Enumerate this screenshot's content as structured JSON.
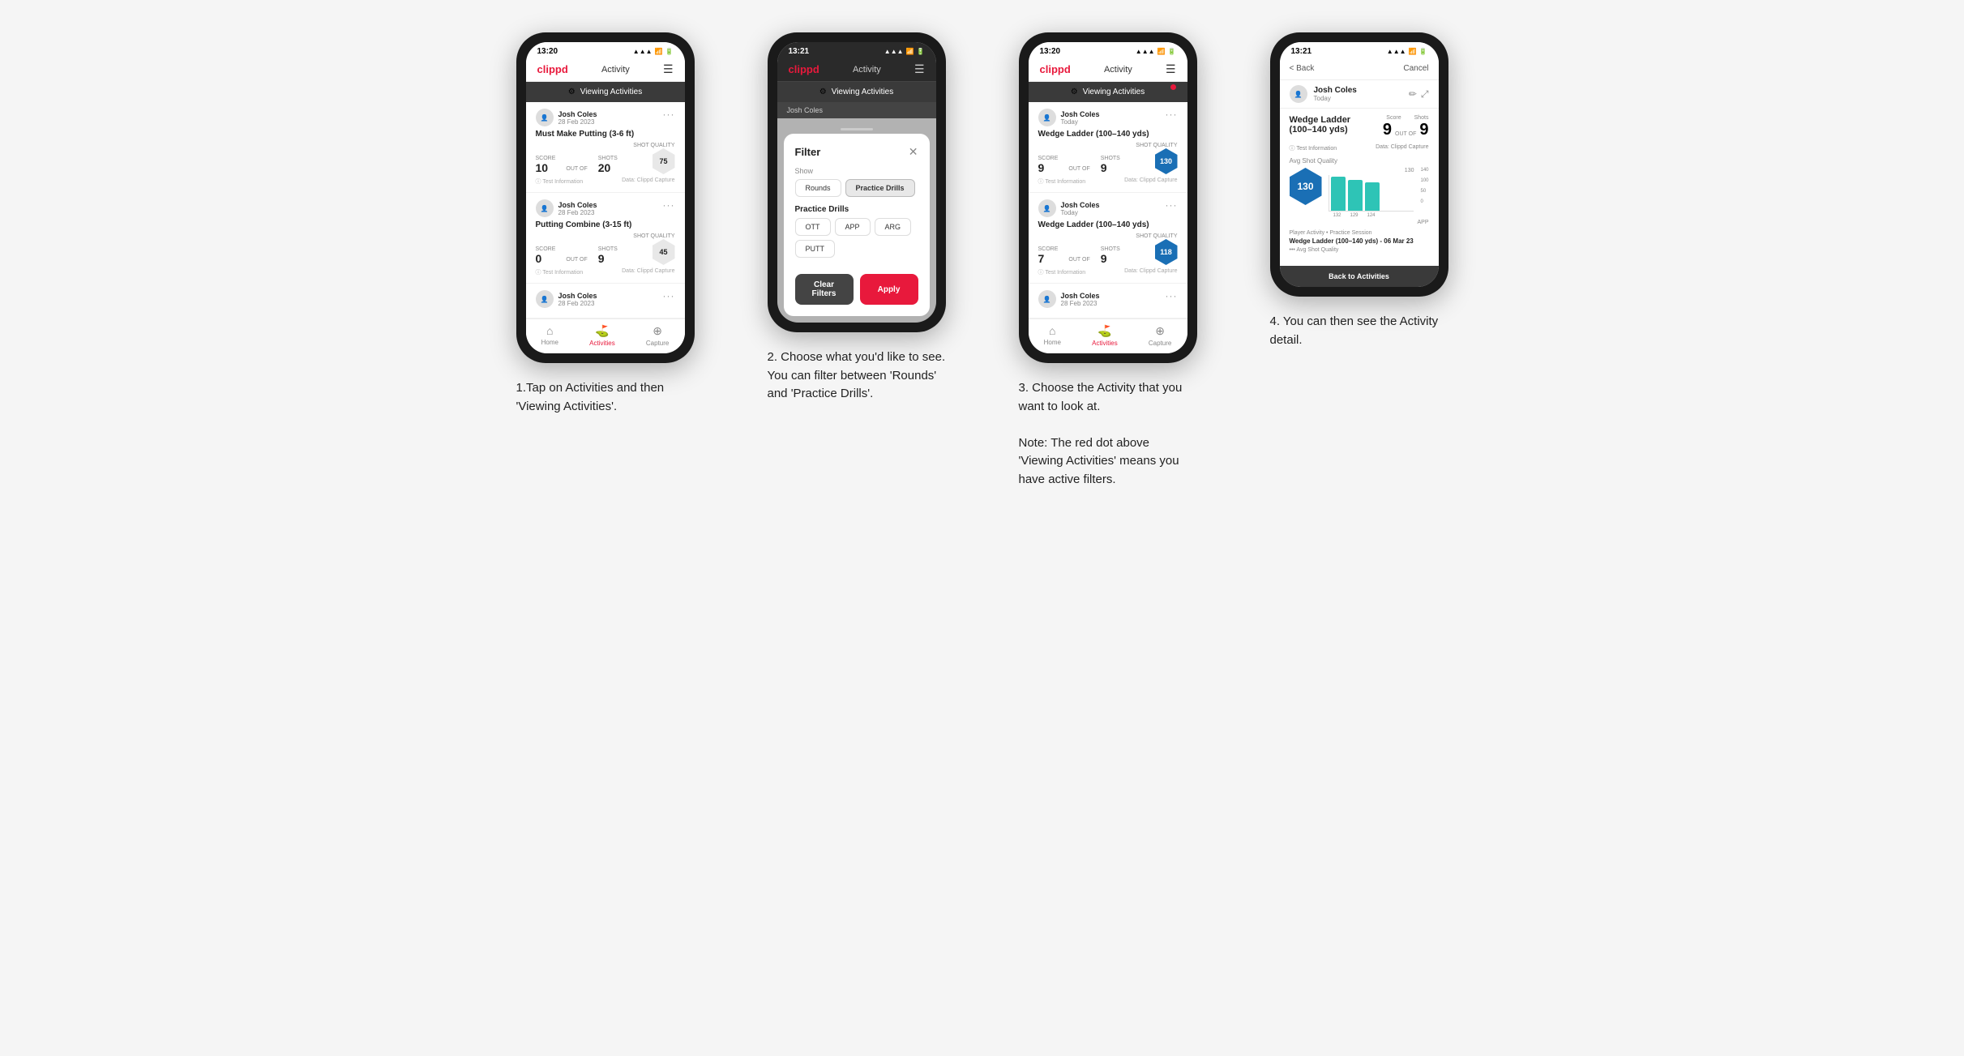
{
  "steps": [
    {
      "id": "step1",
      "phone": {
        "time": "13:20",
        "header": {
          "logo": "clippd",
          "title": "Activity",
          "icon": "☰"
        },
        "viewing_bar": "Viewing Activities",
        "cards": [
          {
            "user": "Josh Coles",
            "date": "28 Feb 2023",
            "title": "Must Make Putting (3-6 ft)",
            "score_label": "Score",
            "shots_label": "Shots",
            "sq_label": "Shot Quality",
            "score": "10",
            "outof": "OUT OF",
            "shots": "20",
            "sq": "75",
            "sq_blue": false,
            "footer_left": "Test Information",
            "footer_right": "Data: Clippd Capture"
          },
          {
            "user": "Josh Coles",
            "date": "28 Feb 2023",
            "title": "Putting Combine (3-15 ft)",
            "score_label": "Score",
            "shots_label": "Shots",
            "sq_label": "Shot Quality",
            "score": "0",
            "outof": "OUT OF",
            "shots": "9",
            "sq": "45",
            "sq_blue": false,
            "footer_left": "Test Information",
            "footer_right": "Data: Clippd Capture"
          },
          {
            "user": "Josh Coles",
            "date": "28 Feb 2023",
            "title": "",
            "score_label": "",
            "shots_label": "",
            "sq_label": "",
            "score": "",
            "outof": "",
            "shots": "",
            "sq": "",
            "sq_blue": false,
            "footer_left": "",
            "footer_right": ""
          }
        ],
        "nav": [
          {
            "label": "Home",
            "icon": "⌂",
            "active": false
          },
          {
            "label": "Activities",
            "icon": "♟",
            "active": true
          },
          {
            "label": "Capture",
            "icon": "⊕",
            "active": false
          }
        ]
      },
      "caption": "1.Tap on Activities and then 'Viewing Activities'."
    },
    {
      "id": "step2",
      "phone": {
        "time": "13:21",
        "header": {
          "logo": "clippd",
          "title": "Activity",
          "icon": "☰"
        },
        "viewing_bar": "Viewing Activities",
        "partial_user": "Josh Coles",
        "filter": {
          "title": "Filter",
          "show_label": "Show",
          "show_options": [
            "Rounds",
            "Practice Drills"
          ],
          "active_show": "Practice Drills",
          "practice_label": "Practice Drills",
          "practice_options": [
            "OTT",
            "APP",
            "ARG",
            "PUTT"
          ],
          "clear_label": "Clear Filters",
          "apply_label": "Apply"
        },
        "nav": [
          {
            "label": "Home",
            "icon": "⌂",
            "active": false
          },
          {
            "label": "Activities",
            "icon": "♟",
            "active": true
          },
          {
            "label": "Capture",
            "icon": "⊕",
            "active": false
          }
        ]
      },
      "caption": "2. Choose what you'd like to see. You can filter between 'Rounds' and 'Practice Drills'."
    },
    {
      "id": "step3",
      "phone": {
        "time": "13:20",
        "header": {
          "logo": "clippd",
          "title": "Activity",
          "icon": "☰"
        },
        "viewing_bar": "Viewing Activities",
        "red_dot": true,
        "cards": [
          {
            "user": "Josh Coles",
            "date": "Today",
            "title": "Wedge Ladder (100–140 yds)",
            "score_label": "Score",
            "shots_label": "Shots",
            "sq_label": "Shot Quality",
            "score": "9",
            "outof": "OUT OF",
            "shots": "9",
            "sq": "130",
            "sq_blue": true,
            "footer_left": "Test Information",
            "footer_right": "Data: Clippd Capture"
          },
          {
            "user": "Josh Coles",
            "date": "Today",
            "title": "Wedge Ladder (100–140 yds)",
            "score_label": "Score",
            "shots_label": "Shots",
            "sq_label": "Shot Quality",
            "score": "7",
            "outof": "OUT OF",
            "shots": "9",
            "sq": "118",
            "sq_blue": true,
            "footer_left": "Test Information",
            "footer_right": "Data: Clippd Capture"
          },
          {
            "user": "Josh Coles",
            "date": "28 Feb 2023",
            "title": "",
            "score_label": "",
            "shots_label": "",
            "sq_label": "",
            "score": "",
            "outof": "",
            "shots": "",
            "sq": "",
            "sq_blue": false,
            "footer_left": "",
            "footer_right": ""
          }
        ],
        "nav": [
          {
            "label": "Home",
            "icon": "⌂",
            "active": false
          },
          {
            "label": "Activities",
            "icon": "♟",
            "active": true
          },
          {
            "label": "Capture",
            "icon": "⊕",
            "active": false
          }
        ]
      },
      "caption": "3. Choose the Activity that you want to look at.\n\nNote: The red dot above 'Viewing Activities' means you have active filters."
    },
    {
      "id": "step4",
      "phone": {
        "time": "13:21",
        "back_label": "< Back",
        "cancel_label": "Cancel",
        "user": "Josh Coles",
        "user_date": "Today",
        "activity_title": "Wedge Ladder\n(100–140 yds)",
        "score_label": "Score",
        "shots_label": "Shots",
        "score": "9",
        "outof": "OUT OF",
        "shots": "9",
        "meta1": "Test Information",
        "meta2": "Data: Clippd Capture",
        "avg_quality_label": "Avg Shot Quality",
        "hex_value": "130",
        "chart_bars": [
          132,
          129,
          124
        ],
        "chart_max": 140,
        "chart_y_labels": [
          "140",
          "100",
          "50",
          "0"
        ],
        "app_label": "APP",
        "player_activity_label": "Player Activity • Practice Session",
        "session_title": "Wedge Ladder (100–140 yds) - 06 Mar 23",
        "session_sub": "••• Avg Shot Quality",
        "back_to_activities": "Back to Activities"
      },
      "caption": "4. You can then see the Activity detail."
    }
  ]
}
